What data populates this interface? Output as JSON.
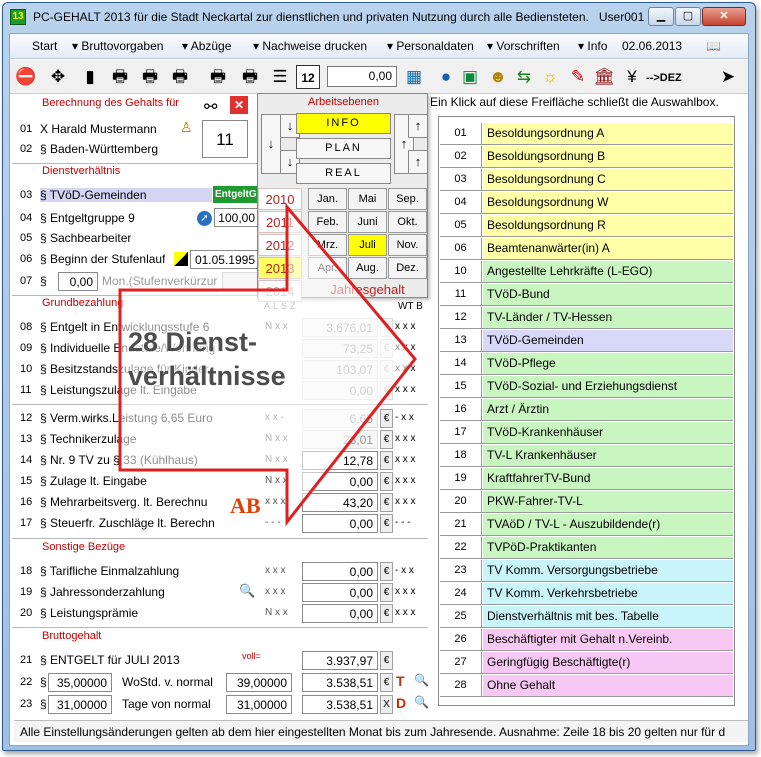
{
  "window": {
    "title": "PC-GEHALT 2013 für die Stadt Neckartal zur dienstlichen und privaten Nutzung durch alle Bediensteten.",
    "user": "User001",
    "app_icon_text": "13"
  },
  "menu": {
    "items": [
      "Start",
      "Bruttovorgaben",
      "Abzüge",
      "Nachweise drucken",
      "Personaldaten",
      "Vorschriften",
      "Info"
    ],
    "date": "02.06.2013"
  },
  "toolbar": {
    "amount": "0,00",
    "dez_label": "-->DEZ"
  },
  "hint": "Ein Klick auf diese Freifläche schließt die Auswahlbox.",
  "left": {
    "sec_berechnung": "Berechnung des Gehalts für",
    "row01": {
      "num": "01",
      "text": "X  Harald Mustermann"
    },
    "row02": {
      "num": "02",
      "text": "§ Baden-Württemberg"
    },
    "month_box": "11",
    "sec_dienst": "Dienstverhältnis",
    "row03": {
      "num": "03",
      "text": "§ TVöD-Gemeinden",
      "tag": "EntgeltG"
    },
    "row04": {
      "num": "04",
      "text": "§ Entgeltgruppe 9",
      "value": "100,00"
    },
    "row05": {
      "num": "05",
      "text": "§ Sachbearbeiter"
    },
    "row06": {
      "num": "06",
      "text": "§ Beginn der Stufenlauf",
      "date": "01.05.1995"
    },
    "row07": {
      "num": "07",
      "text": "§",
      "value": "0,00",
      "label": "Mon.(Stufenverkürzur"
    },
    "sec_grund": "Grundbezahlung",
    "alsz": "ALSZ",
    "wtb": "WT B",
    "row08": {
      "num": "08",
      "text": "§ Entgelt in Entwicklungsstufe 6",
      "flags": "N x x",
      "value": "3.676,01",
      "wtb": "x x x"
    },
    "row09": {
      "num": "09",
      "text": "§ Individuelle Endstufe/Wohnung",
      "flags": "",
      "value": "73,25",
      "wtb": "x x x"
    },
    "row10": {
      "num": "10",
      "text": "§ Besitzstandszulage für Kinder",
      "flags": "",
      "value": "103,07",
      "wtb": "x x x"
    },
    "row11": {
      "num": "11",
      "text": "§ Leistungszulage lt. Eingabe",
      "flags": "",
      "value": "0,00",
      "wtb": "x x x"
    },
    "row12": {
      "num": "12",
      "text": "§ Verm.wirks.Leistung   6,65 Euro",
      "flags": "x x -",
      "value": "6,65",
      "wtb": "- x x"
    },
    "row13": {
      "num": "13",
      "text": "§ Technikerzulage",
      "flags": "N x x",
      "value": "23,01",
      "wtb": "x x x"
    },
    "row14": {
      "num": "14",
      "text": "§ Nr. 9 TV zu § 33 (Kühlhaus)",
      "flags": "N x x",
      "value": "12,78",
      "wtb": "x x x"
    },
    "row15": {
      "num": "15",
      "text": "§ Zulage lt. Eingabe",
      "flags": "N x x",
      "value": "0,00",
      "wtb": "x x x"
    },
    "row16": {
      "num": "16",
      "text": "§ Mehrarbeitsverg. lt. Berechnu",
      "flags": "x x x",
      "value": "43,20",
      "wtb": "x x x"
    },
    "row17": {
      "num": "17",
      "text": "§ Steuerfr. Zuschläge lt. Berechn",
      "flags": "- - -",
      "value": "0,00",
      "wtb": "- - -"
    },
    "sec_sonstige": "Sonstige Bezüge",
    "row18": {
      "num": "18",
      "text": "§ Tarifliche Einmalzahlung",
      "flags": "x x x",
      "value": "0,00",
      "wtb": "- x x"
    },
    "row19": {
      "num": "19",
      "text": "§ Jahressonderzahlung",
      "flags": "x x x",
      "value": "0,00",
      "wtb": "x x x"
    },
    "row20": {
      "num": "20",
      "text": "§ Leistungsprämie",
      "flags": "N x x",
      "value": "0,00",
      "wtb": "x x x"
    },
    "sec_brutto": "Bruttogehalt",
    "row21": {
      "num": "21",
      "text": "§  ENTGELT für JULI  2013",
      "voll": "voll=",
      "value": "3.937,97"
    },
    "row22": {
      "num": "22",
      "text": "§",
      "in": "35,00000",
      "label": "WoStd. v. normal",
      "in2": "39,00000",
      "value": "3.538,51"
    },
    "row23": {
      "num": "23",
      "text": "§",
      "in": "31,00000",
      "label": "Tage von normal",
      "in2": "31,00000",
      "value": "3.538,51"
    }
  },
  "popup": {
    "title": "Arbeitsebenen",
    "levels": [
      "INFO",
      "PLAN",
      "REAL"
    ],
    "years": [
      "2010",
      "2011",
      "2012",
      "2013",
      "2014"
    ],
    "months": [
      "Jan.",
      "Mai",
      "Sep.",
      "Feb.",
      "Juni",
      "Okt.",
      "Mrz.",
      "Juli",
      "Nov.",
      "Apr.",
      "Aug.",
      "Dez."
    ],
    "jahresgehalt": "Jahresgehalt"
  },
  "list": [
    {
      "n": "01",
      "t": "Besoldungsordnung A",
      "c": "#ffffa8"
    },
    {
      "n": "02",
      "t": "Besoldungsordnung B",
      "c": "#ffffa8"
    },
    {
      "n": "03",
      "t": "Besoldungsordnung C",
      "c": "#ffffa8"
    },
    {
      "n": "04",
      "t": "Besoldungsordnung W",
      "c": "#ffffa8"
    },
    {
      "n": "05",
      "t": "Besoldungsordnung R",
      "c": "#ffffa8"
    },
    {
      "n": "06",
      "t": "Beamtenanwärter(in) A",
      "c": "#ffffa8"
    },
    {
      "n": "10",
      "t": "Angestellte Lehrkräfte (L-EGO)",
      "c": "#c9f5c0"
    },
    {
      "n": "11",
      "t": "TVöD-Bund",
      "c": "#c9f5c0"
    },
    {
      "n": "12",
      "t": "TV-Länder  / TV-Hessen",
      "c": "#c9f5c0"
    },
    {
      "n": "13",
      "t": "TVöD-Gemeinden",
      "c": "#d8d8f8"
    },
    {
      "n": "14",
      "t": "TVöD-Pflege",
      "c": "#c9f5c0"
    },
    {
      "n": "15",
      "t": "TVöD-Sozial- und Erziehungsdienst",
      "c": "#c9f5c0"
    },
    {
      "n": "16",
      "t": "Arzt / Ärztin",
      "c": "#c9f5c0"
    },
    {
      "n": "17",
      "t": "TVöD-Krankenhäuser",
      "c": "#c9f5c0"
    },
    {
      "n": "18",
      "t": "TV-L Krankenhäuser",
      "c": "#c9f5c0"
    },
    {
      "n": "19",
      "t": "KraftfahrerTV-Bund",
      "c": "#c9f5c0"
    },
    {
      "n": "20",
      "t": "PKW-Fahrer-TV-L",
      "c": "#c9f5c0"
    },
    {
      "n": "21",
      "t": "TVAöD / TV-L - Auszubildende(r)",
      "c": "#c9f5c0"
    },
    {
      "n": "22",
      "t": "TVPöD-Praktikanten",
      "c": "#c9f5c0"
    },
    {
      "n": "23",
      "t": "TV Komm. Versorgungsbetriebe",
      "c": "#c8f4fa"
    },
    {
      "n": "24",
      "t": "TV Komm. Verkehrsbetriebe",
      "c": "#c8f4fa"
    },
    {
      "n": "25",
      "t": "Dienstverhältnis mit bes. Tabelle",
      "c": "#c8f4fa"
    },
    {
      "n": "26",
      "t": "Beschäftigter mit Gehalt n.Vereinb.",
      "c": "#f8c8f4"
    },
    {
      "n": "27",
      "t": "Geringfügig Beschäftigte(r)",
      "c": "#f8c8f4"
    },
    {
      "n": "28",
      "t": "Ohne Gehalt",
      "c": "#f8c8f4"
    }
  ],
  "status": "Alle Einstellungsänderungen gelten ab dem hier eingestellten Monat bis zum Jahresende. Ausnahme: Zeile 18 bis 20 gelten nur für d",
  "overlay": {
    "text": "28 Dienst-\nverhältnisse"
  },
  "colors": {
    "accent_red": "#c80000",
    "selected_yellow": "#ffff00",
    "arrow_red": "#e02020"
  }
}
